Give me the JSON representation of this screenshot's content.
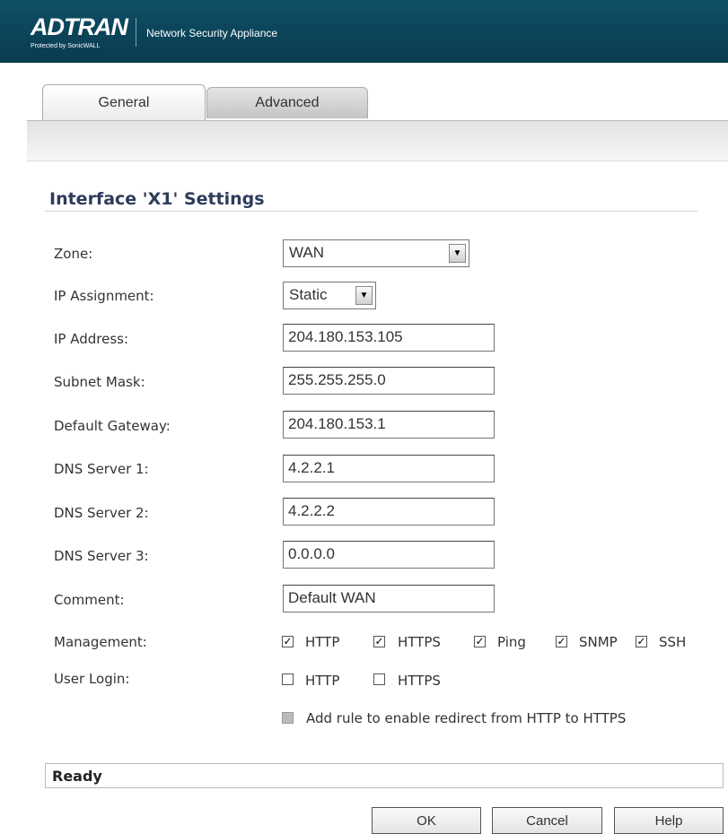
{
  "header": {
    "logo_text": "ADTRAN",
    "logo_subtext": "Protected by SonicWALL",
    "title": "Network Security Appliance"
  },
  "tabs": [
    {
      "label": "General",
      "active": true
    },
    {
      "label": "Advanced",
      "active": false
    }
  ],
  "section_title": "Interface 'X1' Settings",
  "form": {
    "zone": {
      "label": "Zone:",
      "value": "WAN"
    },
    "ip_assignment": {
      "label": "IP Assignment:",
      "value": "Static"
    },
    "ip_address": {
      "label": "IP Address:",
      "value": "204.180.153.105"
    },
    "subnet_mask": {
      "label": "Subnet Mask:",
      "value": "255.255.255.0"
    },
    "default_gateway": {
      "label": "Default Gateway:",
      "value": "204.180.153.1"
    },
    "dns1": {
      "label": "DNS Server 1:",
      "value": "4.2.2.1"
    },
    "dns2": {
      "label": "DNS Server 2:",
      "value": "4.2.2.2"
    },
    "dns3": {
      "label": "DNS Server 3:",
      "value": "0.0.0.0"
    },
    "comment": {
      "label": "Comment:",
      "value": "Default WAN"
    }
  },
  "management": {
    "label": "Management:",
    "options": [
      {
        "label": "HTTP",
        "checked": true
      },
      {
        "label": "HTTPS",
        "checked": true
      },
      {
        "label": "Ping",
        "checked": true
      },
      {
        "label": "SNMP",
        "checked": true
      },
      {
        "label": "SSH",
        "checked": true
      }
    ]
  },
  "user_login": {
    "label": "User Login:",
    "options": [
      {
        "label": "HTTP",
        "checked": false
      },
      {
        "label": "HTTPS",
        "checked": false
      }
    ]
  },
  "redirect_rule": {
    "label": "Add rule to enable redirect from HTTP to HTTPS",
    "checked": false,
    "disabled": true
  },
  "status": "Ready",
  "buttons": {
    "ok": "OK",
    "cancel": "Cancel",
    "help": "Help"
  },
  "colors": {
    "header": "#0a3b4f",
    "section_title": "#2e3c5a"
  },
  "icons": {
    "dropdown": "chevron-down-icon",
    "check": "checkmark-icon"
  }
}
